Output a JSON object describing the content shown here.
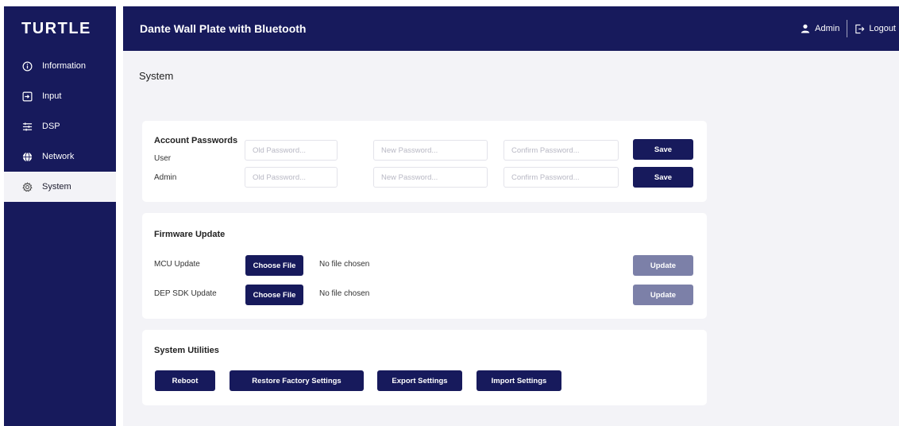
{
  "brand": {
    "logo_text": "TURTLE"
  },
  "header": {
    "title": "Dante Wall Plate with Bluetooth",
    "user_label": "Admin",
    "logout_label": "Logout"
  },
  "sidebar": {
    "items": [
      {
        "label": "Information",
        "icon": "info-icon"
      },
      {
        "label": "Input",
        "icon": "input-icon"
      },
      {
        "label": "DSP",
        "icon": "sliders-icon"
      },
      {
        "label": "Network",
        "icon": "globe-icon"
      },
      {
        "label": "System",
        "icon": "gear-icon",
        "active": true
      }
    ]
  },
  "page": {
    "title": "System"
  },
  "passwords": {
    "title": "Account Passwords",
    "rows": [
      {
        "label": "User",
        "old_placeholder": "Old Password...",
        "new_placeholder": "New Password...",
        "confirm_placeholder": "Confirm Password...",
        "save_label": "Save"
      },
      {
        "label": "Admin",
        "old_placeholder": "Old Password...",
        "new_placeholder": "New Password...",
        "confirm_placeholder": "Confirm Password...",
        "save_label": "Save"
      }
    ]
  },
  "firmware": {
    "title": "Firmware Update",
    "rows": [
      {
        "label": "MCU Update",
        "choose_label": "Choose File",
        "status": "No file chosen",
        "update_label": "Update"
      },
      {
        "label": "DEP SDK Update",
        "choose_label": "Choose File",
        "status": "No file chosen",
        "update_label": "Update"
      }
    ]
  },
  "utilities": {
    "title": "System Utilities",
    "buttons": [
      "Reboot",
      "Restore Factory Settings",
      "Export Settings",
      "Import Settings"
    ]
  },
  "colors": {
    "navy": "#171a5c",
    "disabled_button": "#7c80a8",
    "content_bg": "#f3f3f7"
  }
}
